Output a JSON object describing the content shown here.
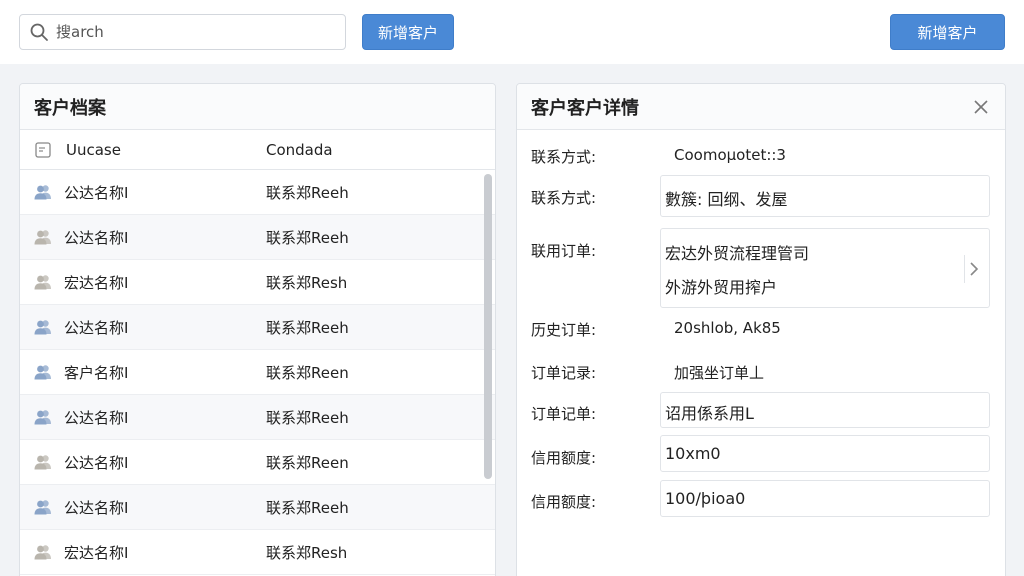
{
  "toolbar": {
    "search_placeholder": "搜arch",
    "add_button_left": "新增客户",
    "add_button_right": "新增客户"
  },
  "customer_list": {
    "title": "客户档案",
    "columns": [
      "Uucase",
      "Condada"
    ],
    "rows": [
      {
        "name": "公达名称I",
        "contact": "联系郑Reeh",
        "icon_color": "#8aa4c8"
      },
      {
        "name": "公达名称I",
        "contact": "联系郑Reeh",
        "icon_color": "#b9b5ad"
      },
      {
        "name": "宏达名称I",
        "contact": "联系郑Resh",
        "icon_color": "#b9b5ad"
      },
      {
        "name": "公达名称I",
        "contact": "联系郑Reeh",
        "icon_color": "#8aa4c8"
      },
      {
        "name": "客户名称I",
        "contact": "联系郑Reen",
        "icon_color": "#8aa4c8"
      },
      {
        "name": "公达名称I",
        "contact": "联系郑Reeh",
        "icon_color": "#8aa4c8"
      },
      {
        "name": "公达名称I",
        "contact": "联系郑Reen",
        "icon_color": "#b9b5ad"
      },
      {
        "name": "公达名称I",
        "contact": "联系郑Reeh",
        "icon_color": "#8aa4c8"
      },
      {
        "name": "宏达名称I",
        "contact": "联系郑Resh",
        "icon_color": "#b9b5ad"
      }
    ]
  },
  "customer_detail": {
    "title": "客户客户详情",
    "fields": {
      "contact_method_1": {
        "label": "联系方式:",
        "value": "Coomoµotet::3"
      },
      "contact_method_2": {
        "label": "联系方式:",
        "value": "數簇: 回纲、发屋"
      },
      "linked_orders": {
        "label": "联用订单:",
        "line1": "宏达外贸流程理管司",
        "line2": "外游外贸用搾户"
      },
      "history_orders": {
        "label": "历史订单:",
        "value": "20shlob, Ak85"
      },
      "order_record_1": {
        "label": "订单记录:",
        "value": "加强坐订单丄"
      },
      "order_record_2": {
        "label": "订单记单:",
        "value": "诏用係系用L"
      },
      "credit_limit_1": {
        "label": "信用额度:",
        "value": "10xm0"
      },
      "credit_limit_2": {
        "label": "信用额度:",
        "value": "100/þioa0"
      }
    }
  },
  "colors": {
    "primary": "#4a89d6",
    "icon_blue": "#8aa4c8",
    "icon_gray": "#b9b5ad"
  }
}
